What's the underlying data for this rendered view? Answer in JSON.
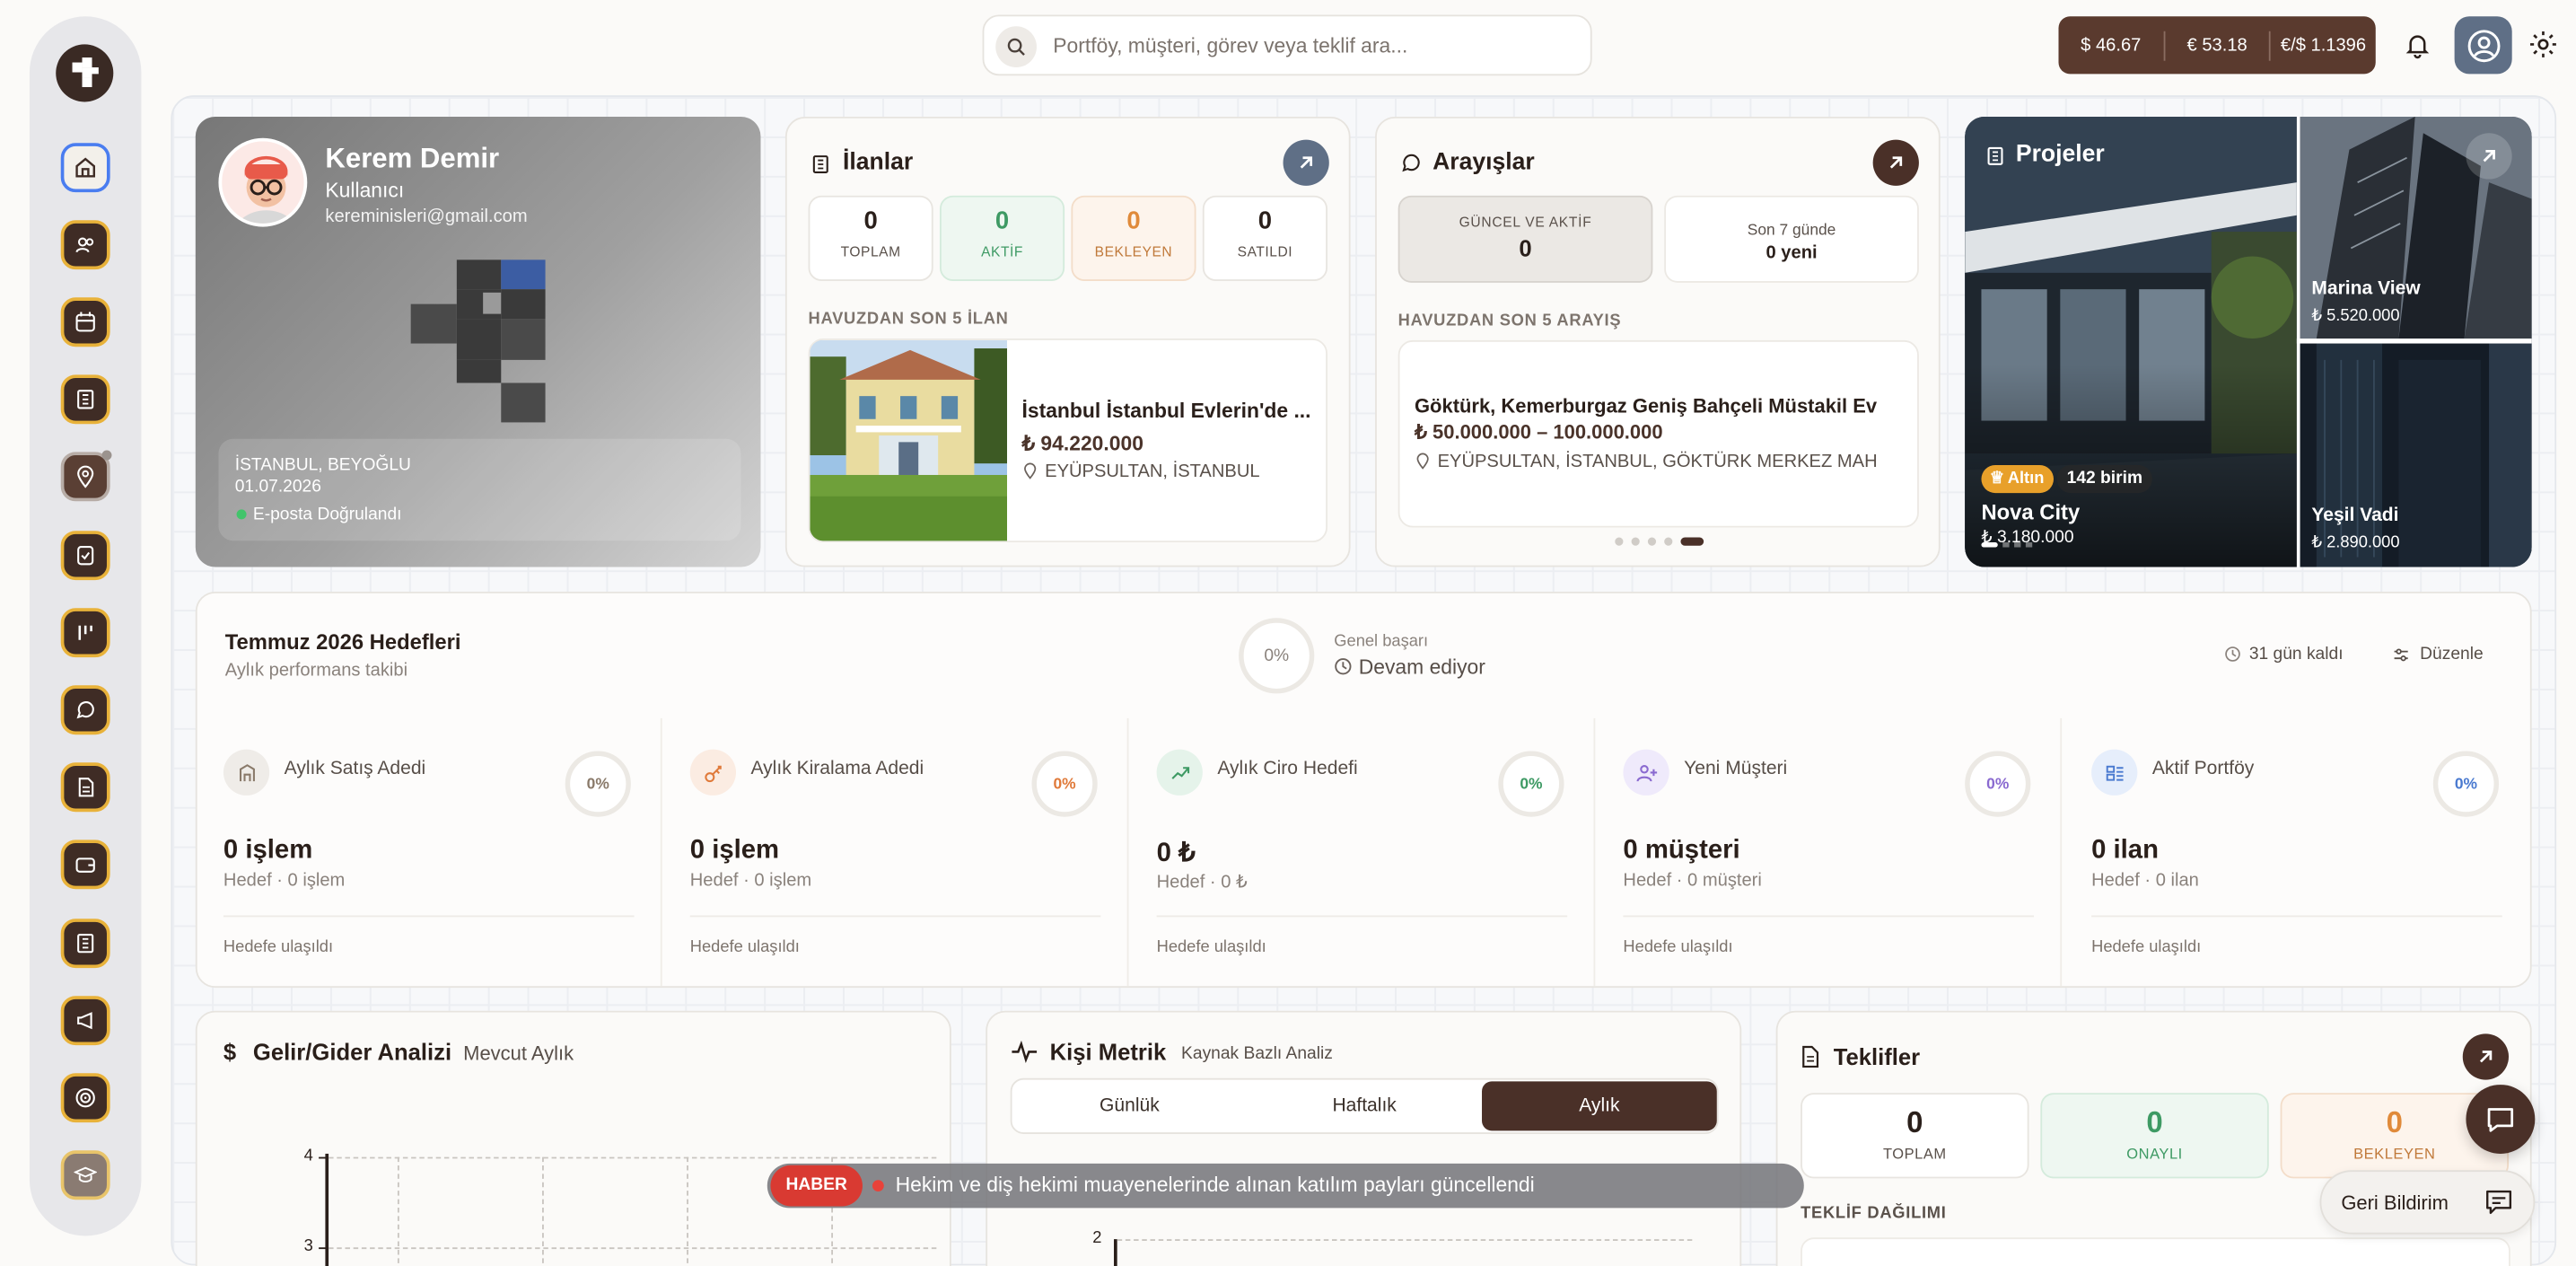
{
  "search": {
    "placeholder": "Portföy, müşteri, görev veya teklif ara..."
  },
  "rates": {
    "usd": "$ 46.67",
    "eur": "€ 53.18",
    "eurusd": "€/$ 1.1396"
  },
  "profile": {
    "name": "Kerem Demir",
    "role": "Kullanıcı",
    "email": "kereminisleri@gmail.com",
    "location": "İSTANBUL, BEYOĞLU",
    "date": "01.07.2026",
    "verified": "E-posta Doğrulandı"
  },
  "ilanlar": {
    "title": "İlanlar",
    "stats": [
      {
        "value": "0",
        "label": "TOPLAM"
      },
      {
        "value": "0",
        "label": "AKTİF"
      },
      {
        "value": "0",
        "label": "BEKLEYEN"
      },
      {
        "value": "0",
        "label": "SATILDI"
      }
    ],
    "section": "HAVUZDAN SON 5 İLAN",
    "listing": {
      "title": "İstanbul İstanbul Evlerin'de ...",
      "price": "₺ 94.220.000",
      "location": "EYÜPSULTAN, İSTANBUL"
    }
  },
  "arayislar": {
    "title": "Arayışlar",
    "current_label": "GÜNCEL VE AKTİF",
    "current_value": "0",
    "week_label": "Son 7 günde",
    "week_value": "0 yeni",
    "section": "HAVUZDAN SON 5 ARAYIŞ",
    "item": {
      "title": "Göktürk, Kemerburgaz Geniş Bahçeli Müstakil Ev",
      "price": "₺ 50.000.000 – 100.000.000",
      "location": "EYÜPSULTAN, İSTANBUL, GÖKTÜRK MERKEZ MAH"
    }
  },
  "projeler": {
    "title": "Projeler",
    "main": {
      "badge": "Altın",
      "units": "142 birim",
      "name": "Nova City",
      "price": "₺ 3.180.000"
    },
    "side": [
      {
        "name": "Marina View",
        "price": "₺ 5.520.000"
      },
      {
        "name": "Yeşil Vadi",
        "price": "₺ 2.890.000"
      }
    ]
  },
  "goals": {
    "title": "Temmuz 2026 Hedefleri",
    "subtitle": "Aylık performans takibi",
    "overall_pct": "0%",
    "overall_label": "Genel başarı",
    "overall_status": "Devam ediyor",
    "days_left": "31 gün kaldı",
    "edit": "Düzenle",
    "items": [
      {
        "name": "Aylık Satış Adedi",
        "pct": "0%",
        "value": "0 işlem",
        "target": "Hedef · 0 işlem",
        "status": "Hedefe ulaşıldı",
        "color": "#8a7a6a",
        "bg": "#efece8"
      },
      {
        "name": "Aylık Kiralama Adedi",
        "pct": "0%",
        "value": "0 işlem",
        "target": "Hedef · 0 işlem",
        "status": "Hedefe ulaşıldı",
        "color": "#e07a3a",
        "bg": "#fbece2"
      },
      {
        "name": "Aylık Ciro Hedefi",
        "pct": "0%",
        "value": "0 ₺",
        "target": "Hedef · 0 ₺",
        "status": "Hedefe ulaşıldı",
        "color": "#3e9a64",
        "bg": "#e5f3ea"
      },
      {
        "name": "Yeni Müşteri",
        "pct": "0%",
        "value": "0 müşteri",
        "target": "Hedef · 0 müşteri",
        "status": "Hedefe ulaşıldı",
        "color": "#8a6ad0",
        "bg": "#efeafb"
      },
      {
        "name": "Aktif Portföy",
        "pct": "0%",
        "value": "0 ilan",
        "target": "Hedef · 0 ilan",
        "status": "Hedefe ulaşıldı",
        "color": "#4a7ad0",
        "bg": "#e6eefb"
      }
    ]
  },
  "gelir": {
    "title": "Gelir/Gider Analizi",
    "period": "Mevcut Aylık",
    "ticks": [
      "4",
      "3"
    ]
  },
  "metrik": {
    "title": "Kişi Metrik",
    "subtitle": "Kaynak Bazlı Analiz",
    "tabs": [
      "Günlük",
      "Haftalık",
      "Aylık"
    ],
    "active_tab": "Aylık",
    "tick": "2"
  },
  "teklifler": {
    "title": "Teklifler",
    "stats": [
      {
        "value": "0",
        "label": "TOPLAM"
      },
      {
        "value": "0",
        "label": "ONAYLI"
      },
      {
        "value": "0",
        "label": "BEKLEYEN"
      }
    ],
    "section": "TEKLİF DAĞILIMI"
  },
  "news": {
    "badge": "HABER",
    "text": "Hekim ve diş hekimi muayenelerinde alınan katılım payları güncellendi"
  },
  "feedback": {
    "label": "Geri Bildirim"
  },
  "colors": {
    "brand": "#3f2c25",
    "accent": "#e8b23a"
  }
}
